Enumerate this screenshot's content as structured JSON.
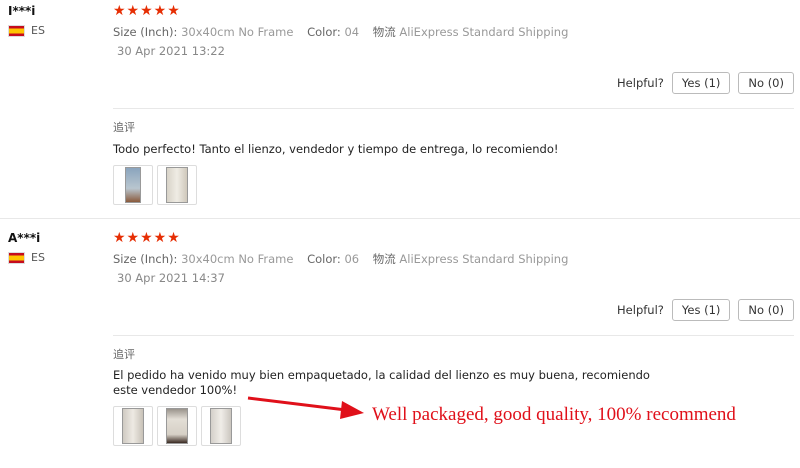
{
  "reviews": [
    {
      "user": "I***i",
      "country": "ES",
      "stars": "★★★★★",
      "size_label": "Size (Inch):",
      "size_value": "30x40cm No Frame",
      "color_label": "Color:",
      "color_value": "04",
      "ship_label": "物流",
      "ship_value": "AliExpress Standard Shipping",
      "date": "30 Apr 2021 13:22",
      "helpful_label": "Helpful?",
      "yes_label": "Yes (1)",
      "no_label": "No (0)",
      "additional_label": "追评",
      "text": "Todo perfecto! Tanto el lienzo, vendedor y tiempo de entrega, lo recomiendo!",
      "thumb_count": 2
    },
    {
      "user": "A***i",
      "country": "ES",
      "stars": "★★★★★",
      "size_label": "Size (Inch):",
      "size_value": "30x40cm No Frame",
      "color_label": "Color:",
      "color_value": "06",
      "ship_label": "物流",
      "ship_value": "AliExpress Standard Shipping",
      "date": "30 Apr 2021 14:37",
      "helpful_label": "Helpful?",
      "yes_label": "Yes (1)",
      "no_label": "No (0)",
      "additional_label": "追评",
      "text": "El pedido ha venido muy bien empaquetado, la calidad del lienzo es muy buena, recomiendo este vendedor 100%!",
      "thumb_count": 3
    }
  ],
  "annotation": "Well packaged, good quality, 100% recommend",
  "colors": {
    "star": "#e62e04",
    "annotation": "#e0101a",
    "flag_red": "#c60b1e",
    "flag_yellow": "#ffc400"
  },
  "icons": {
    "flag": "spain-flag-icon",
    "arrow": "red-arrow-icon"
  }
}
